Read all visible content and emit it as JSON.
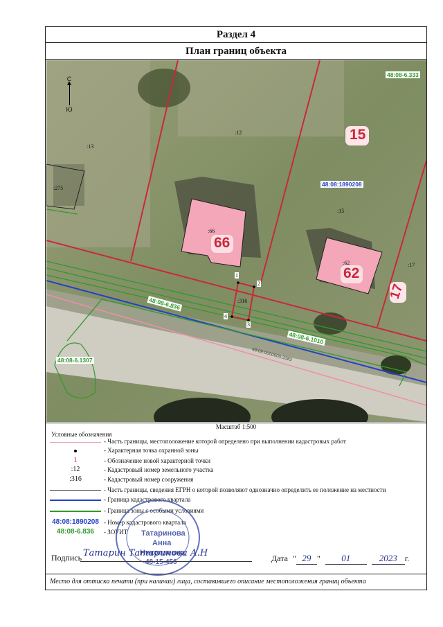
{
  "section_title": "Раздел 4",
  "plan_title": "План границ объекта",
  "compass": {
    "north": "С",
    "south": "Ю"
  },
  "map": {
    "zone_333": "48:08-6.333",
    "zone_836": "48:08-6.836",
    "zone_1010": "48:08-6.1010",
    "zone_1307": "48:08-6.1307",
    "quarter_label": "48:08:1890208",
    "road_label": "48:08:0000000:3382",
    "parcels": {
      "p13": ":13",
      "p12": ":12",
      "p275": ":275",
      "p15": ":15",
      "p17": ":17"
    },
    "buildings": {
      "b66": ":66",
      "b62": ":62",
      "s316": ":316"
    },
    "house_numbers": {
      "n15": "15",
      "n66": "66",
      "n62": "62",
      "n17": "17"
    },
    "points": [
      "1",
      "2",
      "3",
      "4"
    ],
    "colors": {
      "red": "#c9283a",
      "blue": "#2442c4",
      "green": "#2f9a2a",
      "pink": "#f28fa6",
      "map_bg": "#8a9370"
    }
  },
  "scale": "Масштаб 1:500",
  "legend": {
    "title": "Условные обозначения",
    "items": [
      "- Часть границы, местоположение которой определено при выполнении кадастровых работ",
      "- Характерная точка охранной зоны",
      "- Обозначение новой характерной точки",
      "- Кадастровый номер земельного участка",
      "- Кадастровый номер сооружения",
      "- Часть границы, сведения ЕГРН о которой позволяют однозначно определить ее положение на местности",
      "- Граница кадастрового квартала",
      "- Граница зоны с особыми условиями",
      "- Номер кадастрового квартала",
      "- ЗОУИТ"
    ],
    "symbols": {
      "point_num": "1",
      "parcel_num": ":12",
      "structure_num": ":316",
      "quarter_num": "48:08:1890208",
      "zone_num": "48:08-6.836"
    }
  },
  "signature": {
    "label": "Подпись",
    "scrawl": "Татарин Татаринова А.Н",
    "date_label": "Дата",
    "day": "29",
    "month": "01",
    "year": "2023",
    "year_suffix": "г."
  },
  "seal": {
    "line1": "Татаринова",
    "line2": "Анна",
    "line3": "Николаевна",
    "line4": "48-15-456"
  },
  "footer": "Место для оттиска печати (при наличии) лица, составившего описание местоположения границ объекта"
}
